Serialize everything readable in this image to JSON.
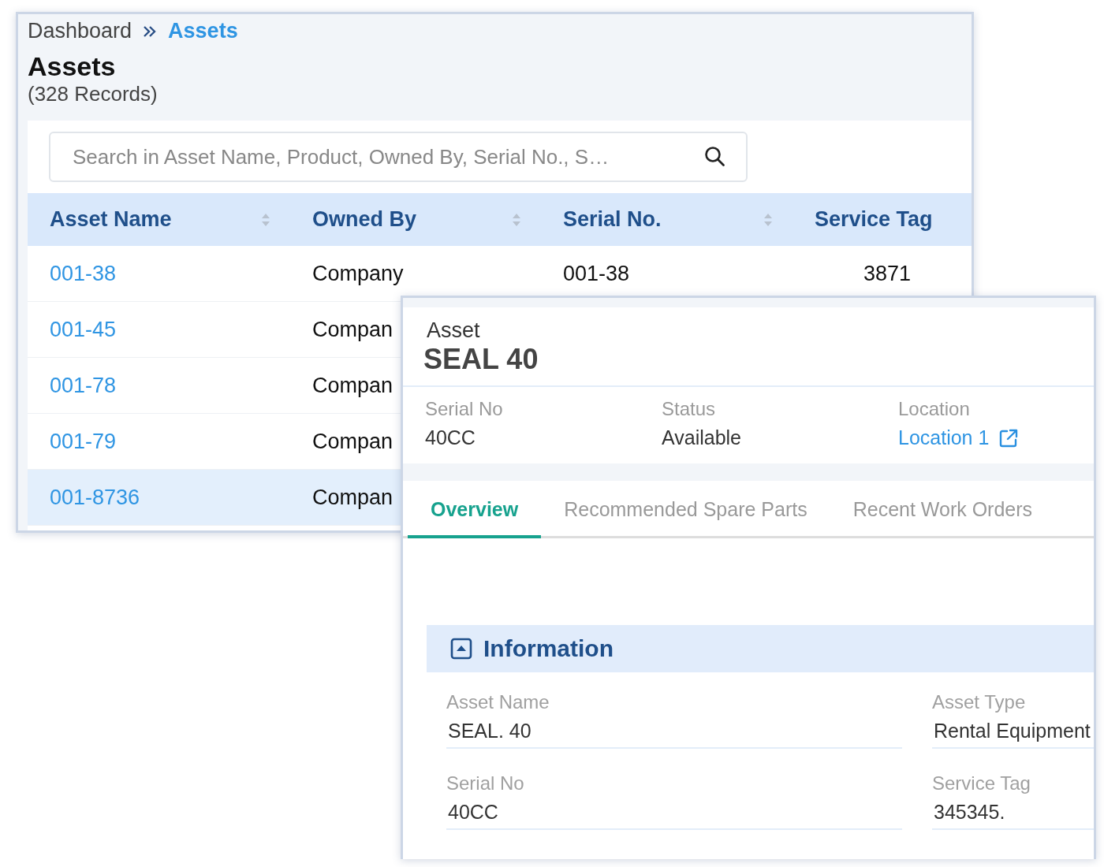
{
  "breadcrumb": [
    {
      "label": "Dashboard",
      "selected": false
    },
    {
      "label": "Assets",
      "selected": true
    }
  ],
  "page": {
    "title": "Assets",
    "count": "(328 Records)"
  },
  "search": {
    "placeholder": "Search in Asset Name, Product, Owned By, Serial No., S…"
  },
  "table": {
    "columns": [
      {
        "label": "Asset Name",
        "sortable": true
      },
      {
        "label": "Owned By",
        "sortable": true
      },
      {
        "label": "Serial No.",
        "sortable": true
      },
      {
        "label": "Service Tag",
        "sortable": false
      }
    ],
    "rows": [
      {
        "cells": [
          "001-38",
          "Company",
          "001-38",
          "3871"
        ],
        "selected": false
      },
      {
        "cells": [
          "001-45",
          "Compan"
        ],
        "selected": false
      },
      {
        "cells": [
          "001-78",
          "Compan"
        ],
        "selected": false
      },
      {
        "cells": [
          "001-79",
          "Compan"
        ],
        "selected": false
      },
      {
        "cells": [
          "001-8736",
          "Compan"
        ],
        "selected": true
      }
    ]
  },
  "detail": {
    "kicker": "Asset",
    "title": "SEAL  40",
    "summary": [
      {
        "label": "Serial No",
        "value": "40CC",
        "kind": "text"
      },
      {
        "label": "Status",
        "value": "Available",
        "kind": "text"
      },
      {
        "label": "Location",
        "value": "Location 1",
        "kind": "link"
      }
    ],
    "tabs": [
      {
        "label": "Overview",
        "selected": true
      },
      {
        "label": "Recommended Spare Parts",
        "selected": false
      },
      {
        "label": "Recent Work Orders",
        "selected": false
      }
    ],
    "section": {
      "title": "Information",
      "expanded": true,
      "fields": [
        {
          "label": "Asset Name",
          "value": "SEAL. 40"
        },
        {
          "label": "Asset Type",
          "value": "Rental Equipment"
        },
        {
          "label": "Serial No",
          "value": "40CC"
        },
        {
          "label": "Service Tag",
          "value": "345345."
        }
      ]
    }
  }
}
